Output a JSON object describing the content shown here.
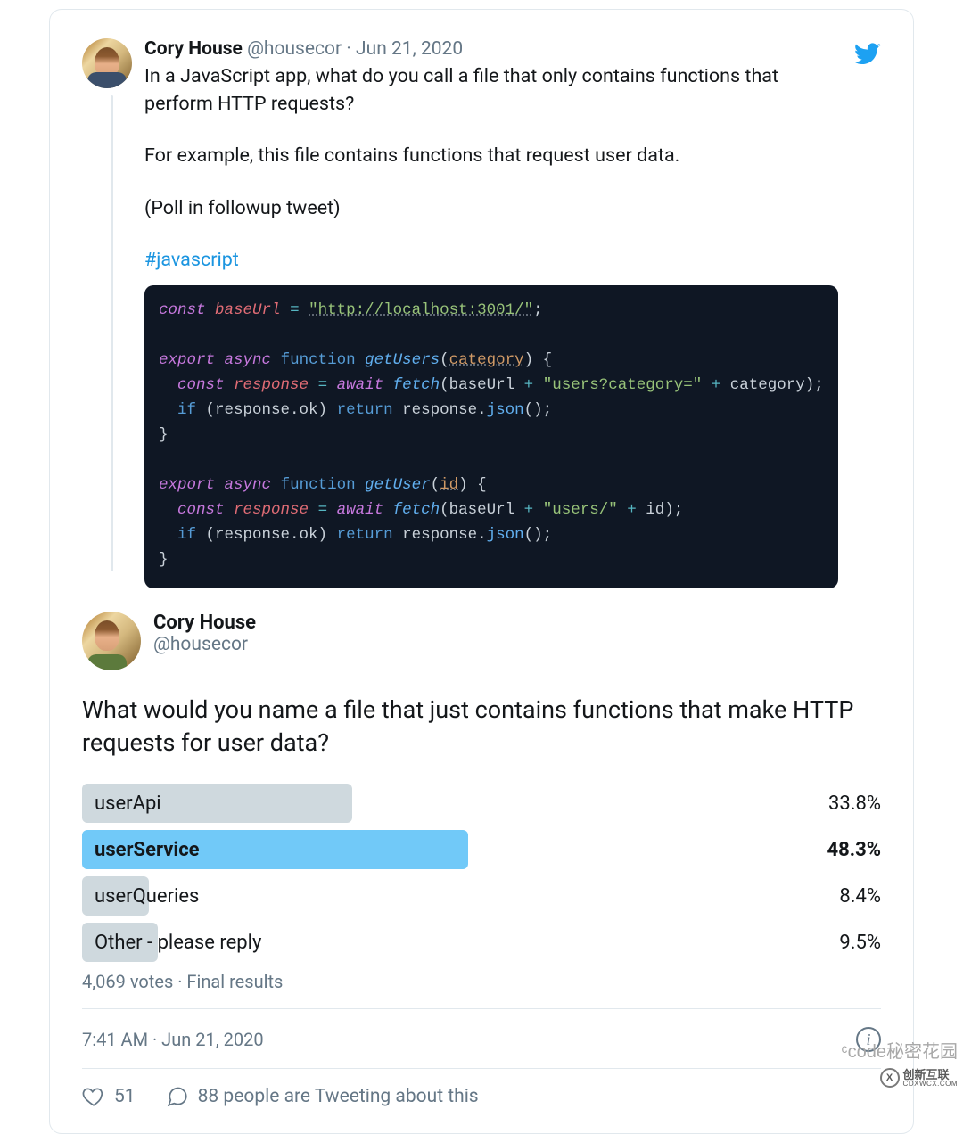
{
  "tweet1": {
    "author_name": "Cory House",
    "author_handle": "@housecor",
    "date": "Jun 21, 2020",
    "para1": "In a JavaScript app, what do you call a file that only contains functions that perform HTTP requests?",
    "para2": "For example, this file contains functions that request user data.",
    "para3": "(Poll in followup tweet)",
    "hashtag": "#javascript",
    "code": {
      "baseUrl": "\"http://localhost:3001/\"",
      "fn1_name": "getUsers",
      "fn1_param": "category",
      "fn1_fetch_str": "\"users?category=\"",
      "fn2_name": "getUser",
      "fn2_param": "id",
      "fn2_fetch_str": "\"users/\""
    }
  },
  "tweet2": {
    "author_name": "Cory House",
    "author_handle": "@housecor",
    "text": "What would you name a file that just contains functions that make HTTP requests for user data?",
    "poll": {
      "options": [
        {
          "label": "userApi",
          "pct_text": "33.8%",
          "width": "33.8%",
          "winner": false
        },
        {
          "label": "userService",
          "pct_text": "48.3%",
          "width": "48.3%",
          "winner": true
        },
        {
          "label": "userQueries",
          "pct_text": "8.4%",
          "width": "8.4%",
          "winner": false
        },
        {
          "label": "Other - please reply",
          "pct_text": "9.5%",
          "width": "9.5%",
          "winner": false
        }
      ],
      "meta": "4,069 votes · Final results"
    },
    "timestamp": "7:41 AM · Jun 21, 2020"
  },
  "footer": {
    "likes": "51",
    "reply_text": "88 people are Tweeting about this"
  },
  "watermark1": "code秘密花园",
  "watermark2_main": "创新互联",
  "watermark2_sub": "CDXWCX.COM",
  "chart_data": {
    "type": "bar",
    "title": "What would you name a file that just contains functions that make HTTP requests for user data?",
    "categories": [
      "userApi",
      "userService",
      "userQueries",
      "Other - please reply"
    ],
    "values": [
      33.8,
      48.3,
      8.4,
      9.5
    ],
    "xlabel": "",
    "ylabel": "percent",
    "ylim": [
      0,
      100
    ],
    "total_votes": 4069,
    "status": "Final results"
  }
}
